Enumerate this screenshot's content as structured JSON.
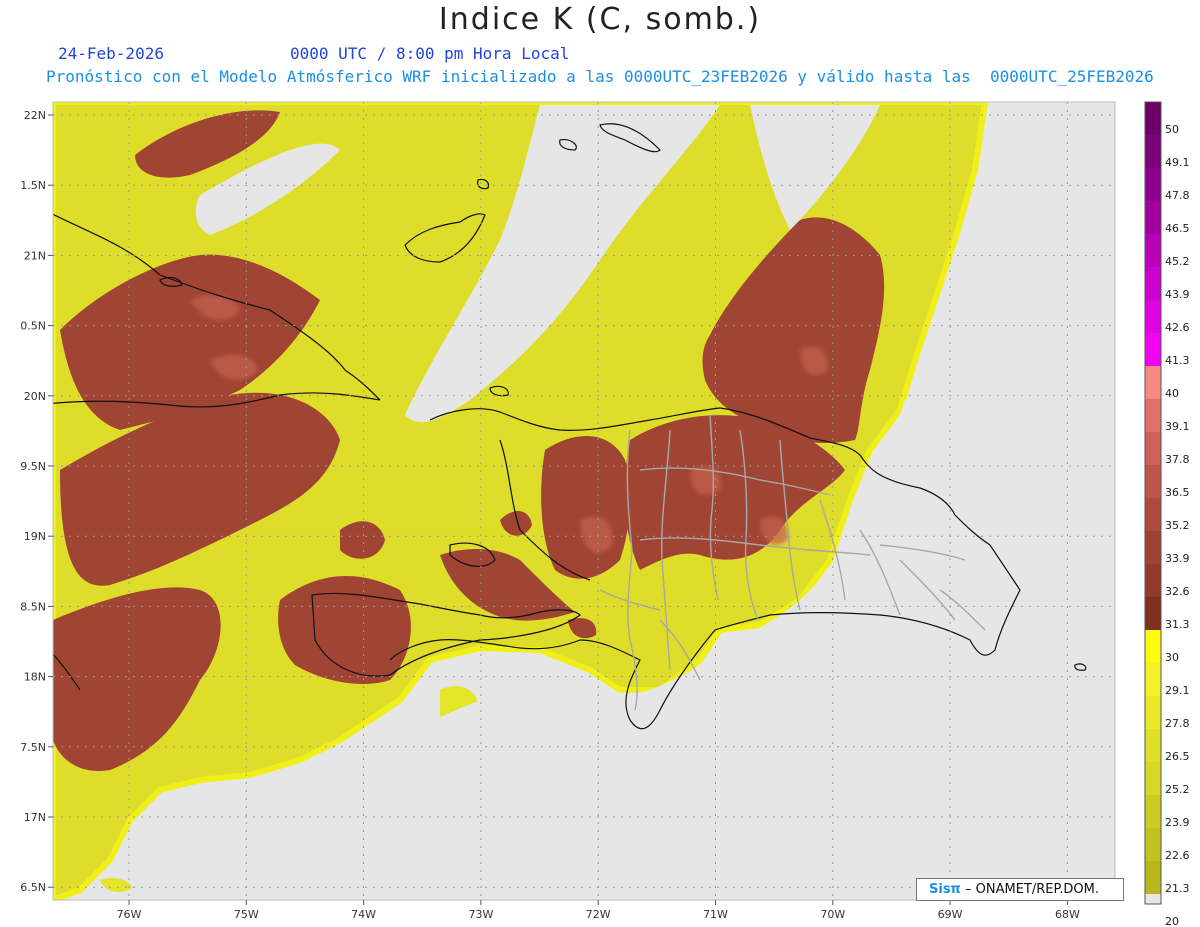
{
  "title": "Indice K (C, somb.)",
  "date": "24-Feb-2026",
  "time": "0000 UTC / 8:00 pm Hora Local",
  "forecast_line": "Pronóstico con el Modelo Atmósferico WRF inicializado a las 0000UTC_23FEB2026 y válido hasta las  0000UTC_25FEB2026",
  "credit": {
    "brand": "Sisπ",
    "separator": "–",
    "org": "ONAMET/REP.DOM."
  },
  "map": {
    "lat_labels": [
      "22N",
      "1.5N",
      "21N",
      "0.5N",
      "20N",
      "9.5N",
      "19N",
      "8.5N",
      "18N",
      "7.5N",
      "17N",
      "6.5N"
    ],
    "lon_labels": [
      "76W",
      "75W",
      "74W",
      "73W",
      "72W",
      "71W",
      "70W",
      "69W",
      "68W"
    ]
  },
  "colorbar": {
    "labels": [
      "50",
      "49.1",
      "47.8",
      "46.5",
      "45.2",
      "43.9",
      "42.6",
      "41.3",
      "40",
      "39.1",
      "37.8",
      "36.5",
      "35.2",
      "33.9",
      "32.6",
      "31.3",
      "30",
      "29.1",
      "27.8",
      "26.5",
      "25.2",
      "23.9",
      "22.6",
      "21.3",
      "20"
    ],
    "colors": [
      "#6b0066",
      "#7a007a",
      "#8e008e",
      "#a300a3",
      "#b800b8",
      "#cc00cc",
      "#e000e0",
      "#f200f2",
      "#f48a82",
      "#e07068",
      "#cf6258",
      "#bf5548",
      "#ad4a3c",
      "#a04232",
      "#923a2a",
      "#7f2f1e",
      "#fbfb10",
      "#f2f227",
      "#e9e928",
      "#e0e026",
      "#d7d724",
      "#cccc22",
      "#c2c220",
      "#b8b81e"
    ]
  }
}
